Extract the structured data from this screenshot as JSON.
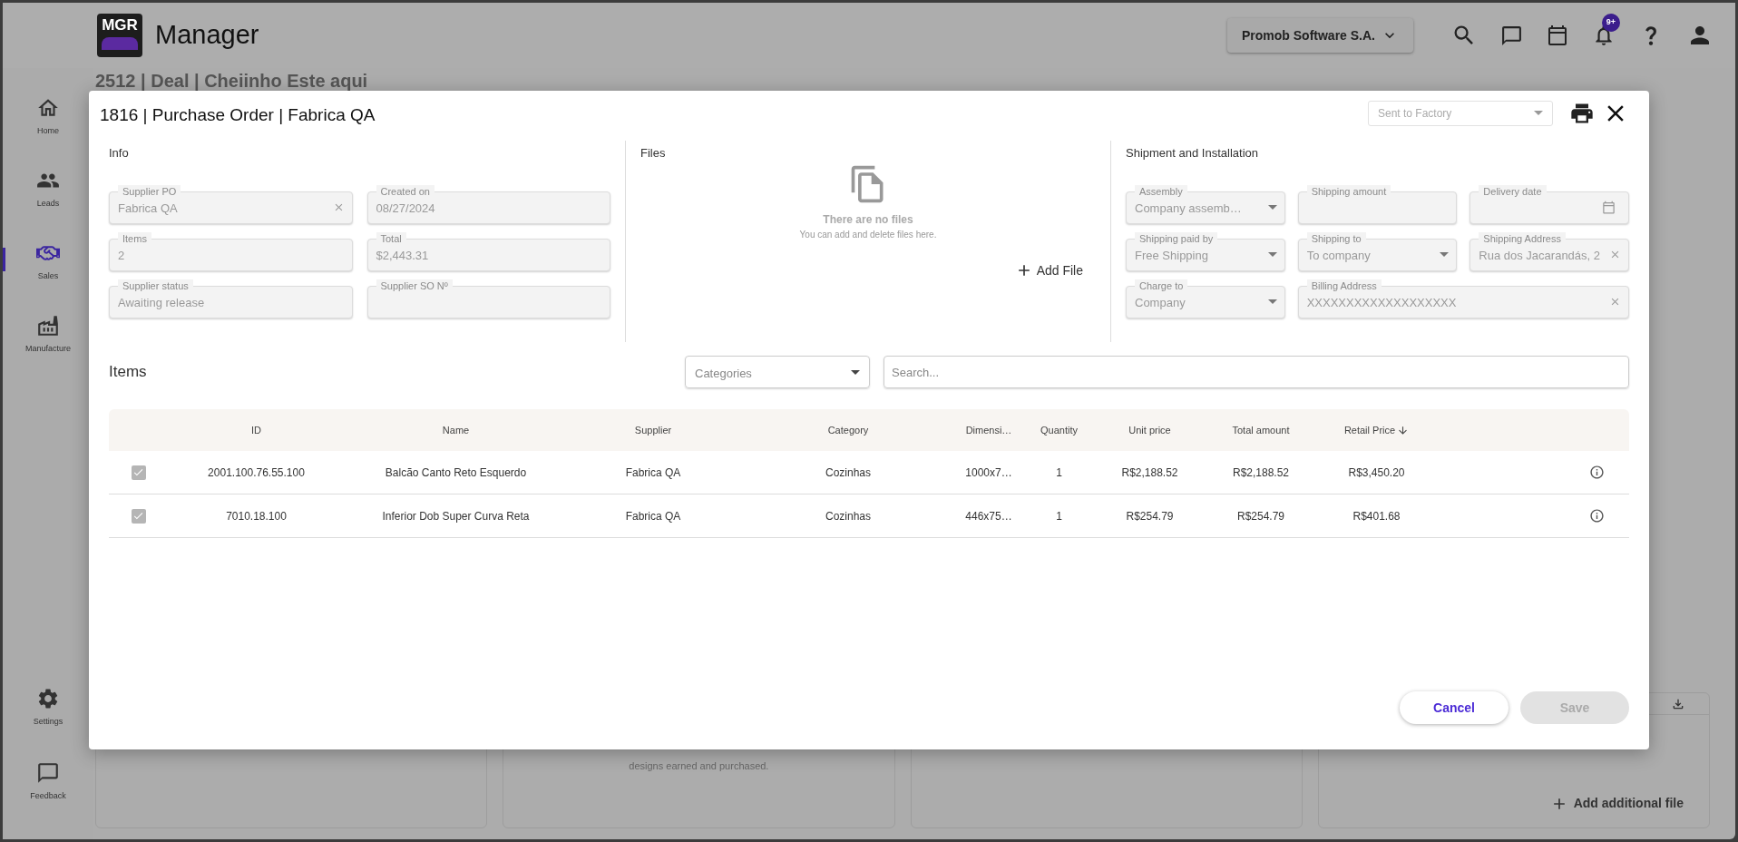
{
  "topbar": {
    "logo_text": "MGR",
    "title": "Manager",
    "company": "Promob Software S.A.",
    "notification_count": "9+"
  },
  "sidebar": {
    "items": [
      {
        "label": "Home",
        "selected": false
      },
      {
        "label": "Leads",
        "selected": false
      },
      {
        "label": "Sales",
        "selected": true
      },
      {
        "label": "Manufacture",
        "selected": false
      }
    ],
    "bottom_items": [
      {
        "label": "Settings"
      },
      {
        "label": "Feedback"
      }
    ]
  },
  "background": {
    "heading": "2512 | Deal | Cheiinho Este aqui",
    "card_text": "designs earned and purchased.",
    "add_file_button": "Add additional file"
  },
  "modal": {
    "title": "1816 | Purchase Order | Fabrica QA",
    "status_select": {
      "placeholder": "Sent to Factory"
    },
    "info": {
      "title": "Info",
      "fields": [
        {
          "label": "Supplier PO",
          "value": "Fabrica QA",
          "clearable": true
        },
        {
          "label": "Created on",
          "value": "08/27/2024",
          "clearable": false
        },
        {
          "label": "Items",
          "value": "2",
          "clearable": false
        },
        {
          "label": "Total",
          "value": "$2,443.31",
          "clearable": false
        },
        {
          "label": "Supplier status",
          "value": "Awaiting release",
          "clearable": false
        },
        {
          "label": "Supplier SO Nº",
          "clearable": false
        }
      ]
    },
    "files": {
      "title": "Files",
      "empty_title": "There are no files",
      "empty_subtitle": "You can add and delete files here.",
      "add_button": "Add File"
    },
    "shipment": {
      "title": "Shipment and Installation",
      "fields": [
        {
          "label": "Assembly",
          "value": "Company assemb…",
          "kind": "select",
          "clearable": false,
          "wide": false
        },
        {
          "label": "Shipping amount",
          "kind": "text",
          "clearable": false,
          "wide": false
        },
        {
          "label": "Delivery date",
          "kind": "date",
          "clearable": false,
          "wide": false
        },
        {
          "label": "Shipping paid by",
          "value": "Free Shipping",
          "kind": "select",
          "clearable": false,
          "wide": false
        },
        {
          "label": "Shipping to",
          "value": "To company",
          "kind": "select",
          "clearable": false,
          "wide": false
        },
        {
          "label": "Shipping Address",
          "value": "Rua dos Jacarandás, 2",
          "kind": "text",
          "clearable": true,
          "wide": false
        },
        {
          "label": "Charge to",
          "value": "Company",
          "kind": "select",
          "clearable": false,
          "wide": false
        },
        {
          "label": "Billing Address",
          "value": "XXXXXXXXXXXXXXXXXXX",
          "kind": "text",
          "clearable": true,
          "wide": true
        }
      ]
    },
    "items": {
      "title": "Items",
      "categories": {
        "placeholder": "Categories"
      },
      "search": {
        "placeholder": "Search..."
      },
      "table": {
        "columns": [
          {
            "label": "ID",
            "sorted": false
          },
          {
            "label": "Name",
            "sorted": false
          },
          {
            "label": "Supplier",
            "sorted": false
          },
          {
            "label": "Category",
            "sorted": false
          },
          {
            "label": "Dimensi…",
            "sorted": false
          },
          {
            "label": "Quantity",
            "sorted": false
          },
          {
            "label": "Unit price",
            "sorted": false
          },
          {
            "label": "Total amount",
            "sorted": false
          },
          {
            "label": "Retail Price",
            "sorted": true
          }
        ],
        "rows": [
          {
            "checked": true,
            "cells": [
              "2001.100.76.55.100",
              "Balcão Canto Reto Esquerdo",
              "Fabrica QA",
              "Cozinhas",
              "1000x7…",
              "1",
              "R$2,188.52",
              "R$2,188.52",
              "R$3,450.20"
            ]
          },
          {
            "checked": true,
            "cells": [
              "7010.18.100",
              "Inferior Dob Super Curva Reta",
              "Fabrica QA",
              "Cozinhas",
              "446x75…",
              "1",
              "R$254.79",
              "R$254.79",
              "R$401.68"
            ]
          }
        ]
      }
    },
    "buttons": {
      "cancel": "Cancel",
      "save": {
        "label": "Save",
        "disabled": true
      }
    }
  }
}
